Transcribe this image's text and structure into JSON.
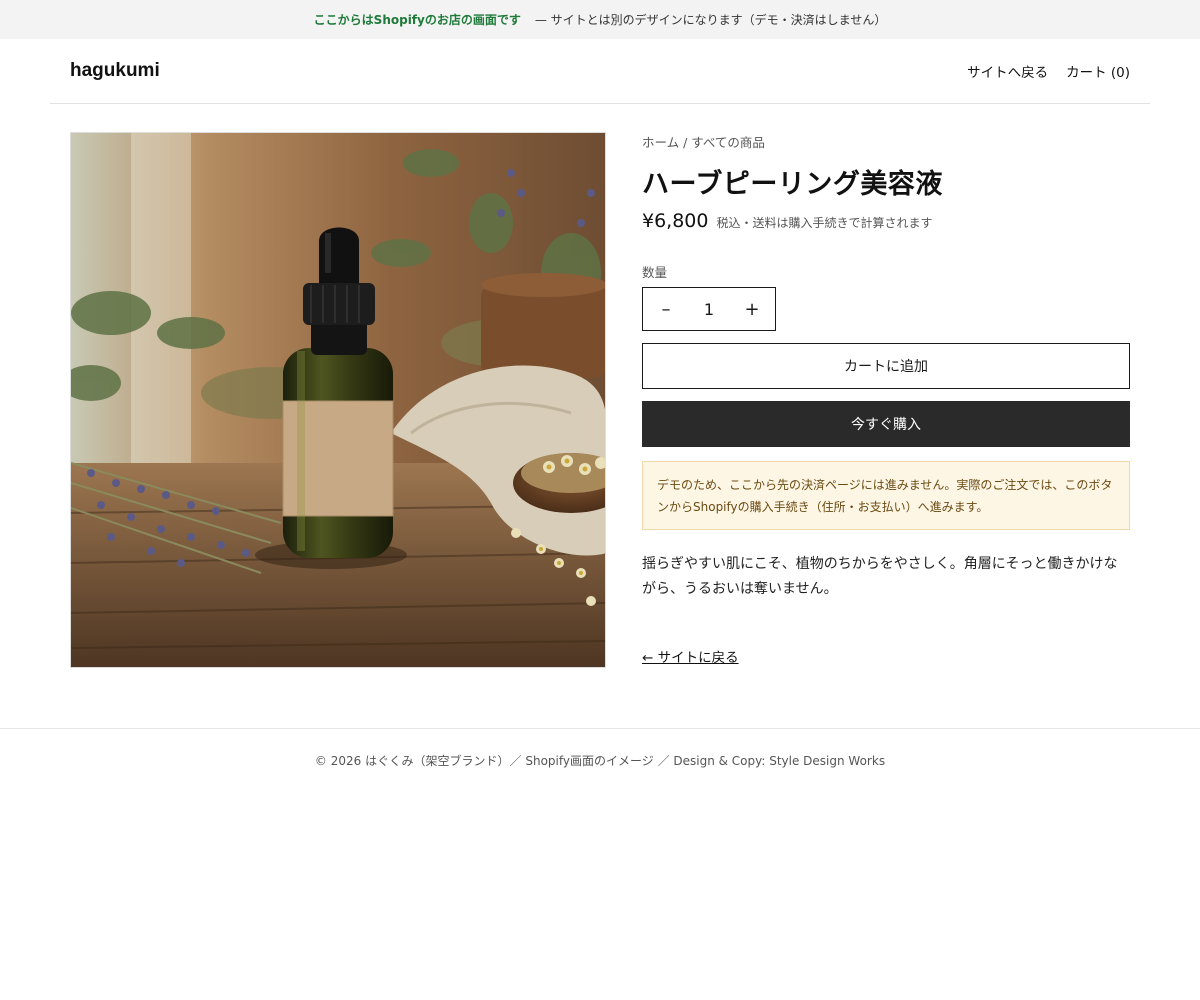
{
  "demo_banner": {
    "lead": "ここからはShopifyのお店の画面です",
    "text": "— サイトとは別のデザインになります（デモ・決済はしません）"
  },
  "header": {
    "logo": "hagukumi",
    "back_to_site": "サイトへ戻る",
    "cart": "カート (0)"
  },
  "product": {
    "breadcrumb": "ホーム / すべての商品",
    "title": "ハーブピーリング美容液",
    "price": "¥6,800",
    "tax_note": "税込・送料は購入手続きで計算されます",
    "quantity_label": "数量",
    "quantity_minus": "–",
    "quantity_value": "1",
    "quantity_plus": "+",
    "add_to_cart": "カートに追加",
    "buy_now": "今すぐ購入",
    "notice": "デモのため、ここから先の決済ページには進みません。実際のご注文では、このボタンからShopifyの購入手続き（住所・お支払い）へ進みます。",
    "description": "揺らぎやすい肌にこそ、植物のちからをやさしく。角層にそっと働きかけながら、うるおいは奪いません。",
    "back_link": "← サイトに戻る"
  },
  "footer": {
    "text": "© 2026 はぐくみ（架空ブランド）／ Shopify画面のイメージ ／ Design & Copy: Style Design Works"
  }
}
